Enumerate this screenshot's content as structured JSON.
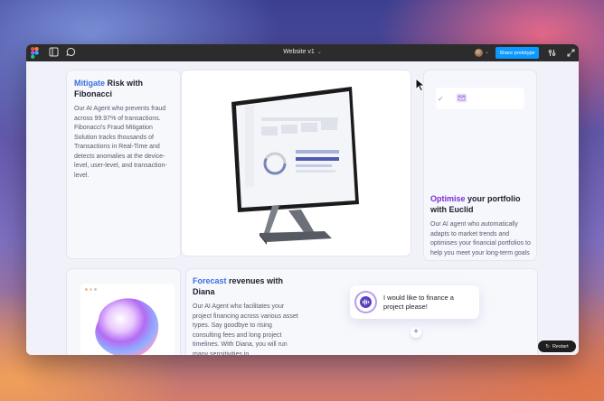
{
  "topbar": {
    "title": "Website v1",
    "share_label": "Share prototype",
    "icons": [
      "figma-logo-icon",
      "panel-icon",
      "comment-icon",
      "chevron-down-icon",
      "settings-icon",
      "expand-icon"
    ]
  },
  "cards": {
    "mitigate": {
      "title_accent": "Mitigate",
      "title_rest": " Risk with Fibonacci",
      "body": "Our AI Agent who prevents fraud across 99.97% of transactions. Fibonacci's Fraud Mitigation Solution tracks thousands of Transactions in Real-Time and detects anomalies at the device-level, user-level, and transaction-level."
    },
    "optimise": {
      "title_accent": "Optimise",
      "title_rest": " your portfolio with Euclid",
      "body": "Our AI agent who automatically adapts to market trends and optimises your financial portfolios to help you meet your long-term goals"
    },
    "forecast": {
      "title_accent": "Forecast",
      "title_rest": " revenues with Diana",
      "body": "Our AI Agent who facilitates your project financing across various asset types. Say goodbye to rising consulting fees and long project timelines. With Diana, you will run many sensitivities in",
      "chat_message": "I would like to finance a project please!"
    }
  },
  "restart_label": "Restart",
  "colors": {
    "topbar": "#2c2c2c",
    "share_button": "#0d99ff",
    "accent_blue": "#3b6fe0",
    "accent_purple": "#7a2fd6"
  }
}
